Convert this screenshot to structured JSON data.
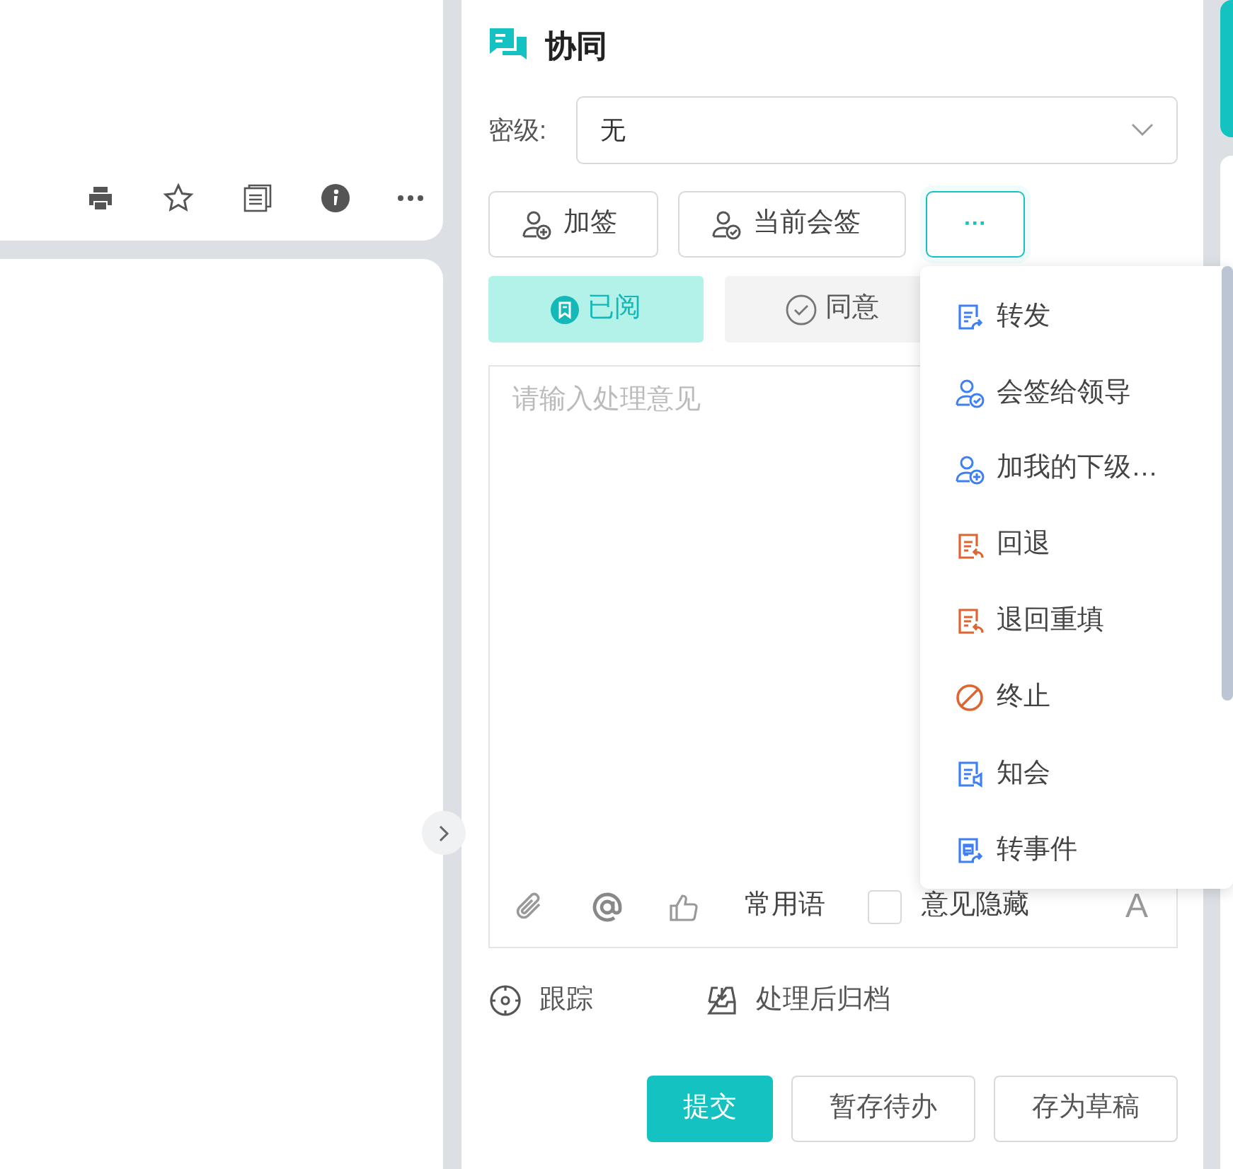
{
  "toolbar": {
    "icons": [
      {
        "kind": "print"
      },
      {
        "kind": "star"
      },
      {
        "kind": "list"
      },
      {
        "kind": "info"
      },
      {
        "kind": "more"
      }
    ]
  },
  "panel": {
    "title": "协同",
    "secret_level": {
      "label": "密级:",
      "value": "无"
    },
    "action_buttons": [
      {
        "label": "加签",
        "kind": "add"
      },
      {
        "label": "当前会签",
        "kind": "cosign"
      },
      {
        "label": "···",
        "kind": "more",
        "selected": true
      }
    ],
    "opinion_tabs": [
      {
        "label": "已阅",
        "selected": true,
        "kind": "read"
      },
      {
        "label": "同意",
        "selected": false,
        "kind": "agree"
      }
    ],
    "opinion": {
      "placeholder": "请输入处理意见"
    },
    "editor_tools": {
      "common_phrases": "常用语",
      "hide_opinion": {
        "label": "意见隐藏",
        "checked": false
      },
      "font_icon": "A"
    },
    "options": [
      {
        "label": "跟踪",
        "kind": "track"
      },
      {
        "label": "处理后归档",
        "kind": "archive"
      }
    ],
    "buttons": [
      {
        "label": "提交",
        "kind": "primary"
      },
      {
        "label": "暂存待办",
        "kind": "default"
      },
      {
        "label": "存为草稿",
        "kind": "default"
      }
    ]
  },
  "menu": {
    "items": [
      {
        "label": "转发",
        "kind": "forward"
      },
      {
        "label": "会签给领导",
        "kind": "cosign"
      },
      {
        "label": "加我的下级…",
        "kind": "add-user"
      },
      {
        "label": "回退",
        "kind": "return"
      },
      {
        "label": "退回重填",
        "kind": "return"
      },
      {
        "label": "终止",
        "kind": "stop"
      },
      {
        "label": "知会",
        "kind": "notify"
      },
      {
        "label": "转事件",
        "kind": "to-event"
      }
    ]
  }
}
